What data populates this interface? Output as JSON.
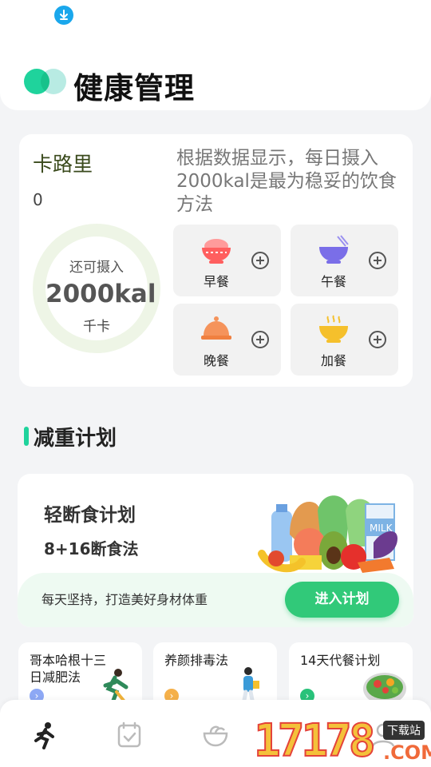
{
  "header": {
    "title": "健康管理"
  },
  "calorie": {
    "title": "卡路里",
    "consumed": "0",
    "ring_top": "还可摄入",
    "ring_value": "2000kal",
    "ring_unit": "千卡",
    "description": "根据数据显示，每日摄入2000kal是最为稳妥的饮食方法",
    "meals": [
      {
        "label": "早餐",
        "icon": "rice-bowl-icon",
        "color": "#ff6b6b"
      },
      {
        "label": "午餐",
        "icon": "noodle-bowl-icon",
        "color": "#7a6ee8"
      },
      {
        "label": "晚餐",
        "icon": "cloche-icon",
        "color": "#f5935b"
      },
      {
        "label": "加餐",
        "icon": "soup-bowl-icon",
        "color": "#f5c02c"
      }
    ]
  },
  "section": {
    "title": "减重计划"
  },
  "plan": {
    "title": "轻断食计划",
    "subtitle": "8+16断食法",
    "motto": "每天坚持，打造美好身材体重",
    "button": "进入计划"
  },
  "mini_plans": [
    {
      "title": "哥本哈根十三日减肥法",
      "arrow_color": "#8da8f5",
      "icon": "runner-illustration-icon"
    },
    {
      "title": "养颜排毒法",
      "arrow_color": "#f5b04a",
      "icon": "walker-illustration-icon"
    },
    {
      "title": "14天代餐计划",
      "arrow_color": "#29c27a",
      "icon": "salad-bowl-icon"
    }
  ],
  "tabs": [
    {
      "icon": "running-icon"
    },
    {
      "icon": "checklist-icon"
    },
    {
      "icon": "food-bowl-icon"
    },
    {
      "icon": "profile-icon"
    }
  ],
  "watermark": {
    "number": "17178",
    "tag": "下载站",
    "suffix": ".COM"
  },
  "colors": {
    "accent": "#1fd39c",
    "button": "#31c979"
  }
}
